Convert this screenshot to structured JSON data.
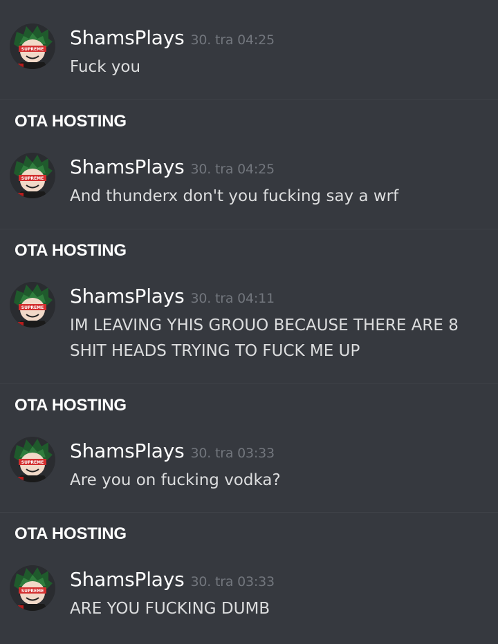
{
  "channel_label": "OTA HOSTING",
  "messages": [
    {
      "author": "ShamsPlays",
      "timestamp": "30. tra 04:25",
      "lines": [
        "Fuck you"
      ]
    },
    {
      "author": "ShamsPlays",
      "timestamp": "30. tra 04:25",
      "lines": [
        "And thunderx don't you fucking say a wrf"
      ]
    },
    {
      "author": "ShamsPlays",
      "timestamp": "30. tra 04:11",
      "lines": [
        "IM LEAVING YHIS GROUO BECAUSE THERE ARE 8",
        "SHIT HEADS TRYING TO FUCK ME UP"
      ]
    },
    {
      "author": "ShamsPlays",
      "timestamp": "30. tra 03:33",
      "lines": [
        "Are you on fucking vodka?"
      ]
    },
    {
      "author": "ShamsPlays",
      "timestamp": "30. tra 03:33",
      "lines": [
        "ARE YOU FUCKING DUMB"
      ]
    }
  ],
  "colors": {
    "background": "#36393f",
    "author": "#ffffff",
    "timestamp": "#72767d",
    "text": "#dcddde"
  },
  "avatar": {
    "icon": "anime-avatar-icon",
    "headband_text": "SUPREME"
  }
}
